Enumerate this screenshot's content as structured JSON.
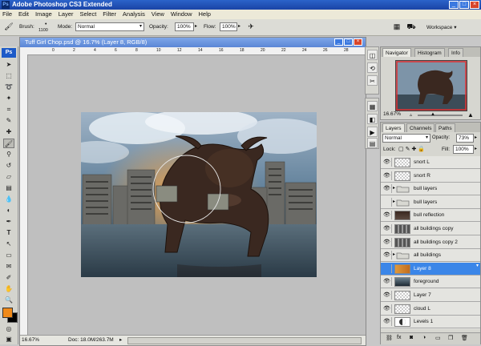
{
  "app": {
    "logo": "Ps",
    "title": "Adobe Photoshop CS3 Extended",
    "window_buttons": [
      "_",
      "□",
      "×"
    ]
  },
  "menu": [
    "File",
    "Edit",
    "Image",
    "Layer",
    "Select",
    "Filter",
    "Analysis",
    "View",
    "Window",
    "Help"
  ],
  "options": {
    "brush_label": "Brush:",
    "brush_size": "1100",
    "mode_label": "Mode:",
    "mode_value": "Normal",
    "opacity_label": "Opacity:",
    "opacity_value": "100%",
    "flow_label": "Flow:",
    "flow_value": "100%",
    "workspace_label": "Workspace ▾"
  },
  "document": {
    "title": "Tuff Girl Chop.psd @ 16.7% (Layer 8, RGB/8)",
    "ruler_ticks": [
      "0",
      "2",
      "4",
      "6",
      "8",
      "10",
      "12",
      "14",
      "16",
      "18",
      "20",
      "22",
      "24",
      "26",
      "28"
    ],
    "status_zoom": "16.67%",
    "status_doc": "Doc: 18.0M/263.7M"
  },
  "navigator": {
    "tabs": [
      "Navigator",
      "Histogram",
      "Info"
    ],
    "zoom": "16.67%"
  },
  "layers_panel": {
    "tabs": [
      "Layers",
      "Channels",
      "Paths"
    ],
    "blend_mode": "Normal",
    "opacity_label": "Opacity:",
    "opacity_value": "73%",
    "lock_label": "Lock:",
    "fill_label": "Fill:",
    "fill_value": "100%",
    "layers": [
      {
        "name": "snort L",
        "kind": "layer",
        "visible": true
      },
      {
        "name": "snort R",
        "kind": "layer",
        "visible": true
      },
      {
        "name": "bull layers",
        "kind": "group",
        "visible": true
      },
      {
        "name": "bull layers",
        "kind": "group",
        "visible": false
      },
      {
        "name": "bull reflection",
        "kind": "layer",
        "visible": true
      },
      {
        "name": "all buildings copy",
        "kind": "layer",
        "visible": true
      },
      {
        "name": "all buildings copy 2",
        "kind": "layer",
        "visible": true
      },
      {
        "name": "all buildings",
        "kind": "group",
        "visible": true
      },
      {
        "name": "Layer 8",
        "kind": "layer",
        "visible": false,
        "selected": true
      },
      {
        "name": "foreground",
        "kind": "layer",
        "visible": true
      },
      {
        "name": "Layer 7",
        "kind": "layer",
        "visible": true
      },
      {
        "name": "cloud L",
        "kind": "layer",
        "visible": true
      },
      {
        "name": "Levels 1",
        "kind": "adjustment",
        "visible": true
      }
    ]
  },
  "colors": {
    "foreground": "#f08a1a",
    "background": "#000000",
    "selection": "#3b86e8"
  }
}
